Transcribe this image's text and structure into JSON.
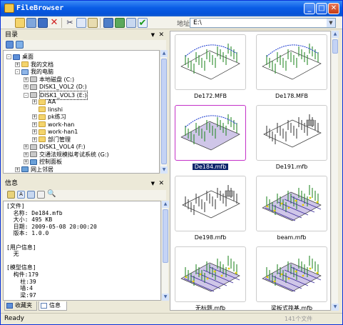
{
  "window": {
    "title": "FileBrowser"
  },
  "toolbar": {
    "address_label": "地址",
    "address_value": "E:\\"
  },
  "tree_panel": {
    "title": "目录",
    "items": [
      {
        "label": "桌面",
        "depth": 0,
        "exp": "-",
        "icon": "desk"
      },
      {
        "label": "我的文档",
        "depth": 1,
        "exp": "+",
        "icon": "doc"
      },
      {
        "label": "我的电脑",
        "depth": 1,
        "exp": "-",
        "icon": "pc"
      },
      {
        "label": "本地磁盘 (C:)",
        "depth": 2,
        "exp": "+",
        "icon": "drive"
      },
      {
        "label": "DISK1_VOL2 (D:)",
        "depth": 2,
        "exp": "+",
        "icon": "drive"
      },
      {
        "label": "DISK1_VOL3 (E:)",
        "depth": 2,
        "exp": "-",
        "icon": "drive"
      },
      {
        "label": "AA",
        "depth": 3,
        "exp": "+",
        "icon": "folder"
      },
      {
        "label": "linshi",
        "depth": 3,
        "exp": "",
        "icon": "folder"
      },
      {
        "label": "pk练习",
        "depth": 3,
        "exp": "+",
        "icon": "folder"
      },
      {
        "label": "work-han",
        "depth": 3,
        "exp": "+",
        "icon": "folder"
      },
      {
        "label": "work-han1",
        "depth": 3,
        "exp": "+",
        "icon": "folder"
      },
      {
        "label": "部门管理",
        "depth": 3,
        "exp": "+",
        "icon": "folder"
      },
      {
        "label": "DISK1_VOL4 (F:)",
        "depth": 2,
        "exp": "+",
        "icon": "drive"
      },
      {
        "label": "交通法规模拟考试系统 (G:)",
        "depth": 2,
        "exp": "+",
        "icon": "drive"
      },
      {
        "label": "控制面板",
        "depth": 2,
        "exp": "+",
        "icon": "panel"
      },
      {
        "label": "网上邻居",
        "depth": 1,
        "exp": "+",
        "icon": "net"
      }
    ]
  },
  "info_panel": {
    "title": "信息",
    "lines": [
      "[文件]",
      "  名称: De184.mfb",
      "  大小: 495 KB",
      "  日期: 2009-05-08 20:00:20",
      "  版本: 1.0.0",
      "",
      "[用户信息]",
      "  无",
      "",
      "[模型信息]",
      "  构件:179",
      "    柱:39",
      "    墙:4",
      "    梁:97"
    ]
  },
  "tabs": [
    "收藏夹",
    "信息"
  ],
  "files": [
    {
      "name": "De172.MFB",
      "selected": false,
      "kind": "curve"
    },
    {
      "name": "De178.MFB",
      "selected": false,
      "kind": "curve2"
    },
    {
      "name": "De184.mfb",
      "selected": true,
      "kind": "curve3"
    },
    {
      "name": "De191.mfb",
      "selected": false,
      "kind": "box"
    },
    {
      "name": "De198.mfb",
      "selected": false,
      "kind": "box2"
    },
    {
      "name": "beam.mfb",
      "selected": false,
      "kind": "beam"
    },
    {
      "name": "无标题.mfb",
      "selected": false,
      "kind": "plat"
    },
    {
      "name": "梁板式筏基.mfb",
      "selected": false,
      "kind": "raft"
    }
  ],
  "status": {
    "text": "Ready",
    "count": "141个文件"
  },
  "colors": {
    "accent": "#0a5de6",
    "selection": "#0a246a",
    "selected_border": "#c432c8"
  }
}
